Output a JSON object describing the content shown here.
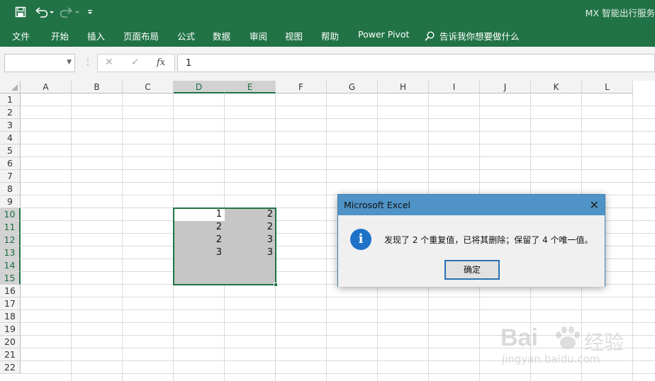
{
  "app": {
    "title": "MX 智能出行服务"
  },
  "qat": {
    "save_icon": "save-icon",
    "undo_icon": "undo-icon",
    "redo_icon": "redo-icon",
    "customize_icon": "customize-icon"
  },
  "ribbon": {
    "tabs": [
      "文件",
      "开始",
      "插入",
      "页面布局",
      "公式",
      "数据",
      "审阅",
      "视图",
      "帮助",
      "Power Pivot"
    ],
    "tell_me": "告诉我你想要做什么"
  },
  "formula_bar": {
    "name_box": "",
    "fx_label": "fx",
    "value": "1"
  },
  "sheet": {
    "columns": [
      "A",
      "B",
      "C",
      "D",
      "E",
      "F",
      "G",
      "H",
      "I",
      "J",
      "K",
      "L"
    ],
    "rows": [
      "1",
      "2",
      "3",
      "4",
      "5",
      "6",
      "7",
      "8",
      "9",
      "10",
      "11",
      "12",
      "13",
      "14",
      "15",
      "16",
      "17",
      "18",
      "19",
      "20",
      "21",
      "22"
    ],
    "selected_columns": [
      "D",
      "E"
    ],
    "selected_rows": [
      "10",
      "11",
      "12",
      "13",
      "14",
      "15"
    ],
    "cells": [
      {
        "ref": "D10",
        "col": "D",
        "row": "10",
        "value": "1"
      },
      {
        "ref": "E10",
        "col": "E",
        "row": "10",
        "value": "2"
      },
      {
        "ref": "D11",
        "col": "D",
        "row": "11",
        "value": "2"
      },
      {
        "ref": "E11",
        "col": "E",
        "row": "11",
        "value": "2"
      },
      {
        "ref": "D12",
        "col": "D",
        "row": "12",
        "value": "2"
      },
      {
        "ref": "E12",
        "col": "E",
        "row": "12",
        "value": "3"
      },
      {
        "ref": "D13",
        "col": "D",
        "row": "13",
        "value": "3"
      },
      {
        "ref": "E13",
        "col": "E",
        "row": "13",
        "value": "3"
      }
    ]
  },
  "dialog": {
    "title": "Microsoft Excel",
    "close_label": "✕",
    "icon": "info-icon",
    "message": "发现了 2 个重复值，已将其删除；保留了 4 个唯一值。",
    "ok_label": "确定"
  },
  "watermark": {
    "brand": "Bai",
    "brand_suffix": "经验",
    "url": "jingyan.baidu.com"
  }
}
